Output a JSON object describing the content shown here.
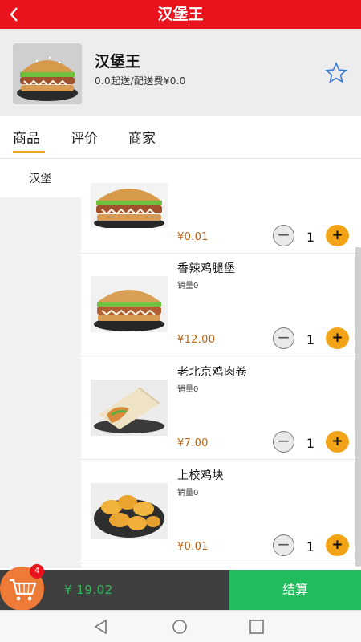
{
  "header": {
    "title": "汉堡王",
    "back_icon": "chevron-left-icon"
  },
  "store": {
    "name": "汉堡王",
    "subtitle": "0.0起送/配送费¥0.0",
    "favorite_icon": "star-outline-icon"
  },
  "tabs": [
    {
      "label": "商品",
      "active": true
    },
    {
      "label": "评价",
      "active": false
    },
    {
      "label": "商家",
      "active": false
    }
  ],
  "sidebar": {
    "items": [
      {
        "label": "汉堡",
        "selected": true
      }
    ]
  },
  "list": {
    "category": "汉堡",
    "items": [
      {
        "name": "",
        "sales": "",
        "price": "¥0.01",
        "qty": "1"
      },
      {
        "name": "香辣鸡腿堡",
        "sales": "销量0",
        "price": "¥12.00",
        "qty": "1"
      },
      {
        "name": "老北京鸡肉卷",
        "sales": "销量0",
        "price": "¥7.00",
        "qty": "1"
      },
      {
        "name": "上校鸡块",
        "sales": "销量0",
        "price": "¥0.01",
        "qty": "1"
      }
    ],
    "minus_label": "−",
    "plus_label": "+"
  },
  "cart": {
    "badge": "4",
    "total": "¥ 19.02",
    "checkout_label": "结算",
    "cart_icon": "shopping-cart-icon"
  },
  "colors": {
    "brand_red": "#e8131d",
    "accent_orange": "#f3a318",
    "checkout_green": "#20bc5e",
    "price_color": "#c0600a"
  },
  "navbar": {
    "icons": [
      "back-triangle-icon",
      "home-circle-icon",
      "recents-square-icon"
    ]
  }
}
